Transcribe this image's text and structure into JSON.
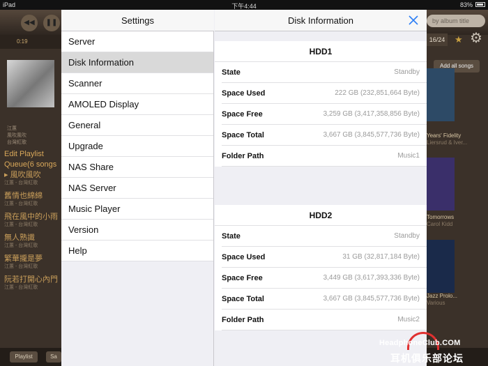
{
  "status_bar": {
    "carrier": "iPad",
    "time": "下午4:44",
    "battery": "83%"
  },
  "background_app": {
    "elapsed": "0:19",
    "album_meta": [
      "江蕙",
      "風吹風吹",
      "台灣紅歌"
    ],
    "edit_playlist": "Edit Playlist",
    "queue_label": "Queue(6 songs",
    "songs": [
      {
        "title": "▸ 風吹風吹",
        "artist": "江蕙 - 台灣紅歌"
      },
      {
        "title": "舊情也綿綿",
        "artist": "江蕙 - 台灣紅歌"
      },
      {
        "title": "飛在風中的小雨",
        "artist": "江蕙 - 台灣紅歌"
      },
      {
        "title": "無人熟識",
        "artist": "江蕙 - 台灣紅歌"
      },
      {
        "title": "繁華攏是夢",
        "artist": "江蕙 - 台灣紅歌"
      },
      {
        "title": "阮若打開心內門",
        "artist": "江蕙 - 台灣紅歌"
      }
    ],
    "bottom_buttons": [
      "Playlist",
      "Sa"
    ],
    "search_placeholder": "by album title",
    "page_count": "16/24",
    "add_all": "Add all songs",
    "albums": [
      {
        "title": "Years' Fidelity",
        "artist": "Liersrud & Iver...",
        "color": "#2d4a66"
      },
      {
        "title": "Tomorrows",
        "artist": "Carol Kidd",
        "color": "#3a2f6a"
      },
      {
        "title": "Jazz Prolo...",
        "artist": "Various",
        "color": "#1a2a4a"
      }
    ]
  },
  "settings": {
    "title": "Settings",
    "items": [
      "Server",
      "Disk Information",
      "Scanner",
      "AMOLED Display",
      "General",
      "Upgrade",
      "NAS Share",
      "NAS Server",
      "Music Player",
      "Version",
      "Help"
    ],
    "selected": "Disk Information"
  },
  "disk_info": {
    "title": "Disk Information",
    "accent": "#2d7ff5",
    "disks": [
      {
        "name": "HDD1",
        "rows": [
          {
            "label": "State",
            "value": "Standby"
          },
          {
            "label": "Space Used",
            "value": "222 GB (232,851,664 Byte)"
          },
          {
            "label": "Space Free",
            "value": "3,259 GB (3,417,358,856 Byte)"
          },
          {
            "label": "Space Total",
            "value": "3,667 GB (3,845,577,736 Byte)"
          },
          {
            "label": "Folder Path",
            "value": "Music1"
          }
        ]
      },
      {
        "name": "HDD2",
        "rows": [
          {
            "label": "State",
            "value": "Standby"
          },
          {
            "label": "Space Used",
            "value": "31 GB (32,817,184 Byte)"
          },
          {
            "label": "Space Free",
            "value": "3,449 GB (3,617,393,336 Byte)"
          },
          {
            "label": "Space Total",
            "value": "3,667 GB (3,845,577,736 Byte)"
          },
          {
            "label": "Folder Path",
            "value": "Music2"
          }
        ]
      }
    ]
  },
  "watermark": {
    "line1": "HeadphoneClub.COM",
    "line2": "耳机俱乐部论坛"
  }
}
